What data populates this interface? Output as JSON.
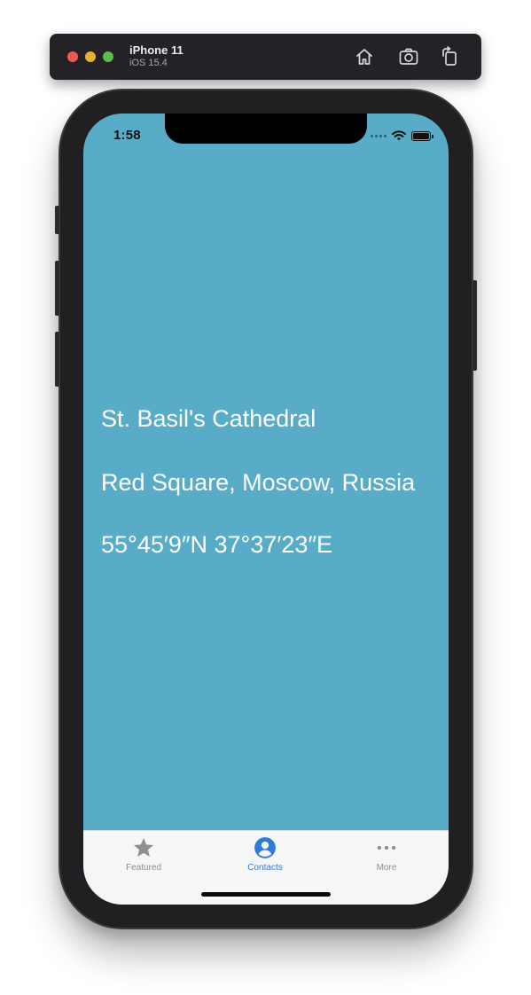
{
  "simulator": {
    "device_name": "iPhone 11",
    "os_version": "iOS 15.4",
    "buttons": {
      "home_icon": "home-icon",
      "screenshot_icon": "camera-icon",
      "rotate_icon": "rotate-icon"
    }
  },
  "status_bar": {
    "time": "1:58"
  },
  "content": {
    "name": "St. Basil's Cathedral",
    "location": "Red Square, Moscow, Russia",
    "coordinates": "55°45′9″N 37°37′23″E"
  },
  "tab_bar": {
    "tabs": [
      {
        "label": "Featured",
        "icon": "star-icon",
        "selected": false
      },
      {
        "label": "Contacts",
        "icon": "person-circle-icon",
        "selected": true
      },
      {
        "label": "More",
        "icon": "ellipsis-icon",
        "selected": false
      }
    ]
  },
  "colors": {
    "screen_background": "#58acc8",
    "tab_active": "#2f7bdb",
    "tab_inactive": "#8e8e93",
    "content_text": "#ffffff"
  }
}
